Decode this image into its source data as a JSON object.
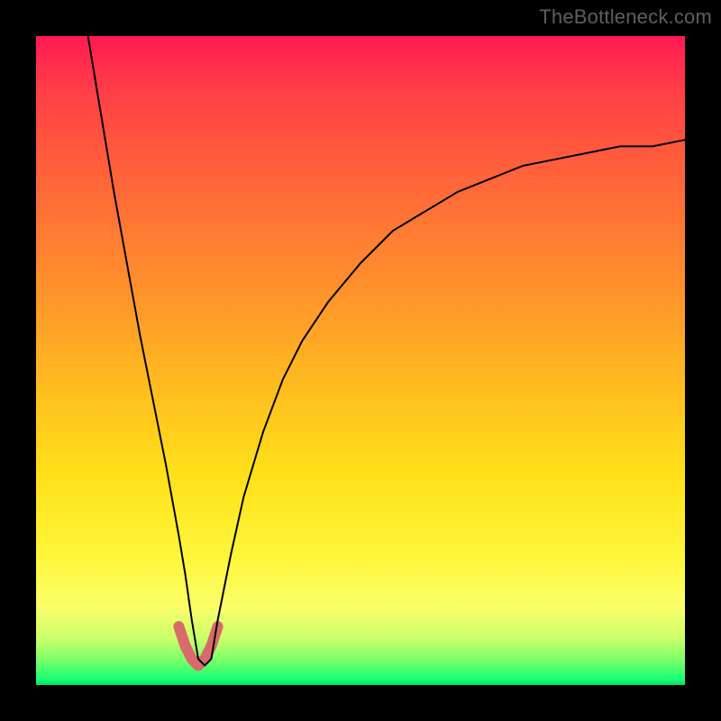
{
  "watermark": "TheBottleneck.com",
  "chart_data": {
    "type": "line",
    "title": "",
    "xlabel": "",
    "ylabel": "",
    "xlim": [
      0,
      100
    ],
    "ylim": [
      0,
      100
    ],
    "grid": false,
    "legend": false,
    "series": [
      {
        "name": "main-curve",
        "color": "#000000",
        "stroke_width": 2,
        "x": [
          8,
          10,
          12,
          14,
          16,
          18,
          20,
          22,
          23,
          24,
          25,
          26,
          27,
          28,
          30,
          32,
          35,
          38,
          41,
          45,
          50,
          55,
          60,
          65,
          70,
          75,
          80,
          85,
          90,
          95,
          100
        ],
        "y": [
          100,
          88,
          76,
          65,
          54,
          44,
          34,
          23,
          17,
          10,
          4,
          3,
          4,
          10,
          20,
          29,
          39,
          47,
          53,
          59,
          65,
          70,
          73,
          76,
          78,
          80,
          81,
          82,
          83,
          83,
          84
        ]
      },
      {
        "name": "highlight-segment",
        "color": "#d86a6a",
        "stroke_width": 12,
        "x": [
          22,
          23,
          24,
          25,
          26,
          27,
          28
        ],
        "y": [
          9,
          6,
          4,
          3,
          4,
          6,
          9
        ]
      }
    ]
  },
  "colors": {
    "frame_bg": "#000000",
    "curve": "#000000",
    "highlight": "#d86a6a",
    "watermark": "#5e5e5e"
  }
}
